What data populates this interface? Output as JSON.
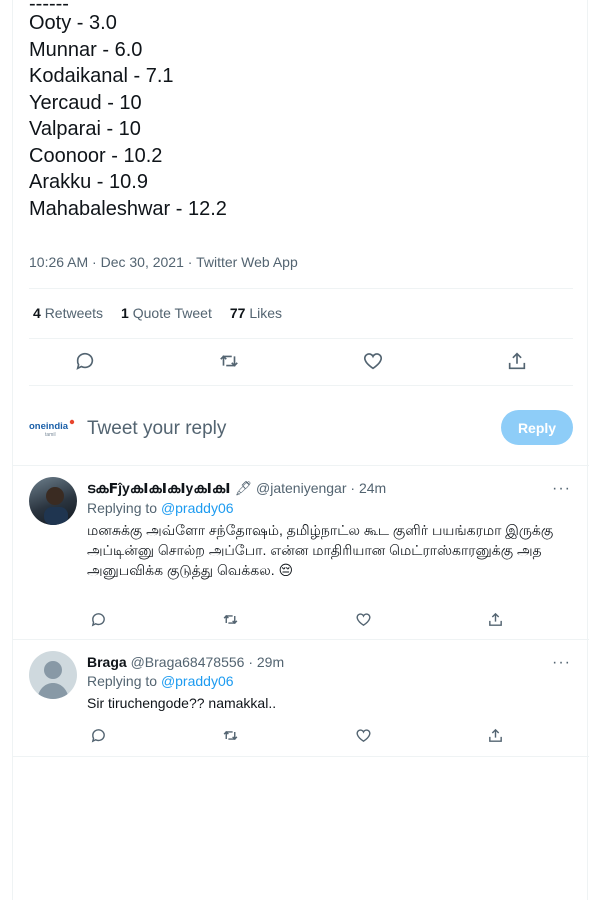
{
  "tweet": {
    "dashes": "------",
    "lines": [
      "Ooty - 3.0",
      "Munnar - 6.0",
      "Kodaikanal - 7.1",
      "Yercaud - 10",
      "Valparai - 10",
      "Coonoor - 10.2",
      "Arakku - 10.9",
      "Mahabaleshwar - 12.2"
    ],
    "timestamp": "10:26 AM · Dec 30, 2021 · Twitter Web App",
    "stats": {
      "retweets_count": "4",
      "retweets_label": "Retweets",
      "quotes_count": "1",
      "quotes_label": "Quote Tweet",
      "likes_count": "77",
      "likes_label": "Likes"
    }
  },
  "reply_box": {
    "logo_text": "oneindia",
    "logo_sub": "tamil",
    "placeholder": "Tweet your reply",
    "button_label": "Reply"
  },
  "replies": [
    {
      "name": "ടകꓝĵyകꓲകꓲകꓲyകꓲകꓲ",
      "name_emoji": "🖋",
      "handle": "@jateniyengar · 24m",
      "replying_label": "Replying to",
      "replying_to": "@praddy06",
      "text": "மனசுக்கு அவ்ளோ சந்தோஷம், தமிழ்நாட்ல கூட குளிர் பயங்கரமா இருக்கு அப்டின்னு சொல்ற அப்போ. என்ன மாதிரியான மெட்ராஸ்காரனுக்கு அத அனுபவிக்க குடுத்து வெக்கல. 😔",
      "more": "···"
    },
    {
      "name": "Braga",
      "name_emoji": "",
      "handle": "@Braga68478556 · 29m",
      "replying_label": "Replying to",
      "replying_to": "@praddy06",
      "text": "Sir tiruchengode?? namakkal..",
      "more": "···"
    }
  ],
  "colors": {
    "accent": "#1d9bf0",
    "reply_button_disabled": "#8ecdf8",
    "muted_text": "#536471",
    "divider": "#eff3f4"
  },
  "icons": [
    "reply-icon",
    "retweet-icon",
    "like-icon",
    "share-icon",
    "more-icon"
  ]
}
